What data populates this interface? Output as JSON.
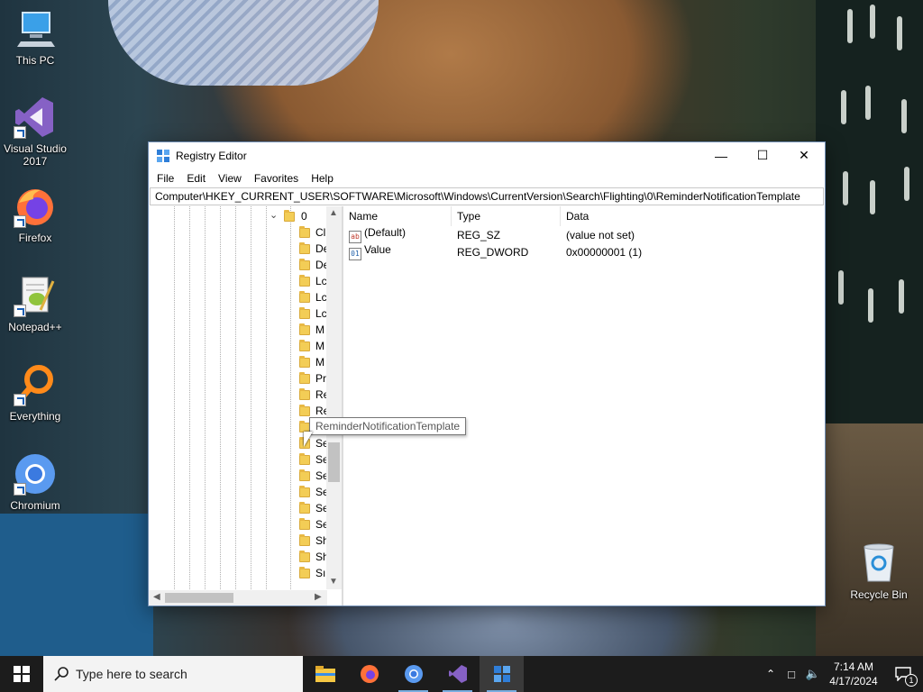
{
  "desktop": {
    "icons": [
      {
        "label": "This PC"
      },
      {
        "label": "Visual Studio 2017"
      },
      {
        "label": "Firefox"
      },
      {
        "label": "Notepad++"
      },
      {
        "label": "Everything"
      },
      {
        "label": "Chromium"
      },
      {
        "label": "Recycle Bin"
      }
    ]
  },
  "window": {
    "title": "Registry Editor",
    "controls": {
      "minimize": "—",
      "maximize": "☐",
      "close": "✕"
    },
    "menu": [
      "File",
      "Edit",
      "View",
      "Favorites",
      "Help"
    ],
    "address": "Computer\\HKEY_CURRENT_USER\\SOFTWARE\\Microsoft\\Windows\\CurrentVersion\\Search\\Flighting\\0\\ReminderNotificationTemplate",
    "tree": {
      "expanded_key": "0",
      "children": [
        "Cl",
        "De",
        "De",
        "Lc",
        "Lc",
        "Lc",
        "M",
        "M",
        "M",
        "Pr",
        "Re",
        "Re",
        "",
        "Se",
        "Se",
        "Se",
        "Se",
        "Se",
        "Se",
        "Sh",
        "Sh",
        "Sı"
      ]
    },
    "list": {
      "columns": [
        "Name",
        "Type",
        "Data"
      ],
      "rows": [
        {
          "icon": "string-value-icon",
          "icon_text": "ab",
          "name": "(Default)",
          "type": "REG_SZ",
          "data": "(value not set)"
        },
        {
          "icon": "dword-value-icon",
          "icon_text": "01",
          "name": "Value",
          "type": "REG_DWORD",
          "data": "0x00000001 (1)"
        }
      ]
    },
    "tooltip": "ReminderNotificationTemplate"
  },
  "taskbar": {
    "search_placeholder": "Type here to search",
    "pinned": [
      "file-explorer",
      "firefox",
      "chromium",
      "visual-studio",
      "registry-editor"
    ],
    "clock": {
      "time": "7:14 AM",
      "date": "4/17/2024"
    },
    "notification_count": "1"
  }
}
